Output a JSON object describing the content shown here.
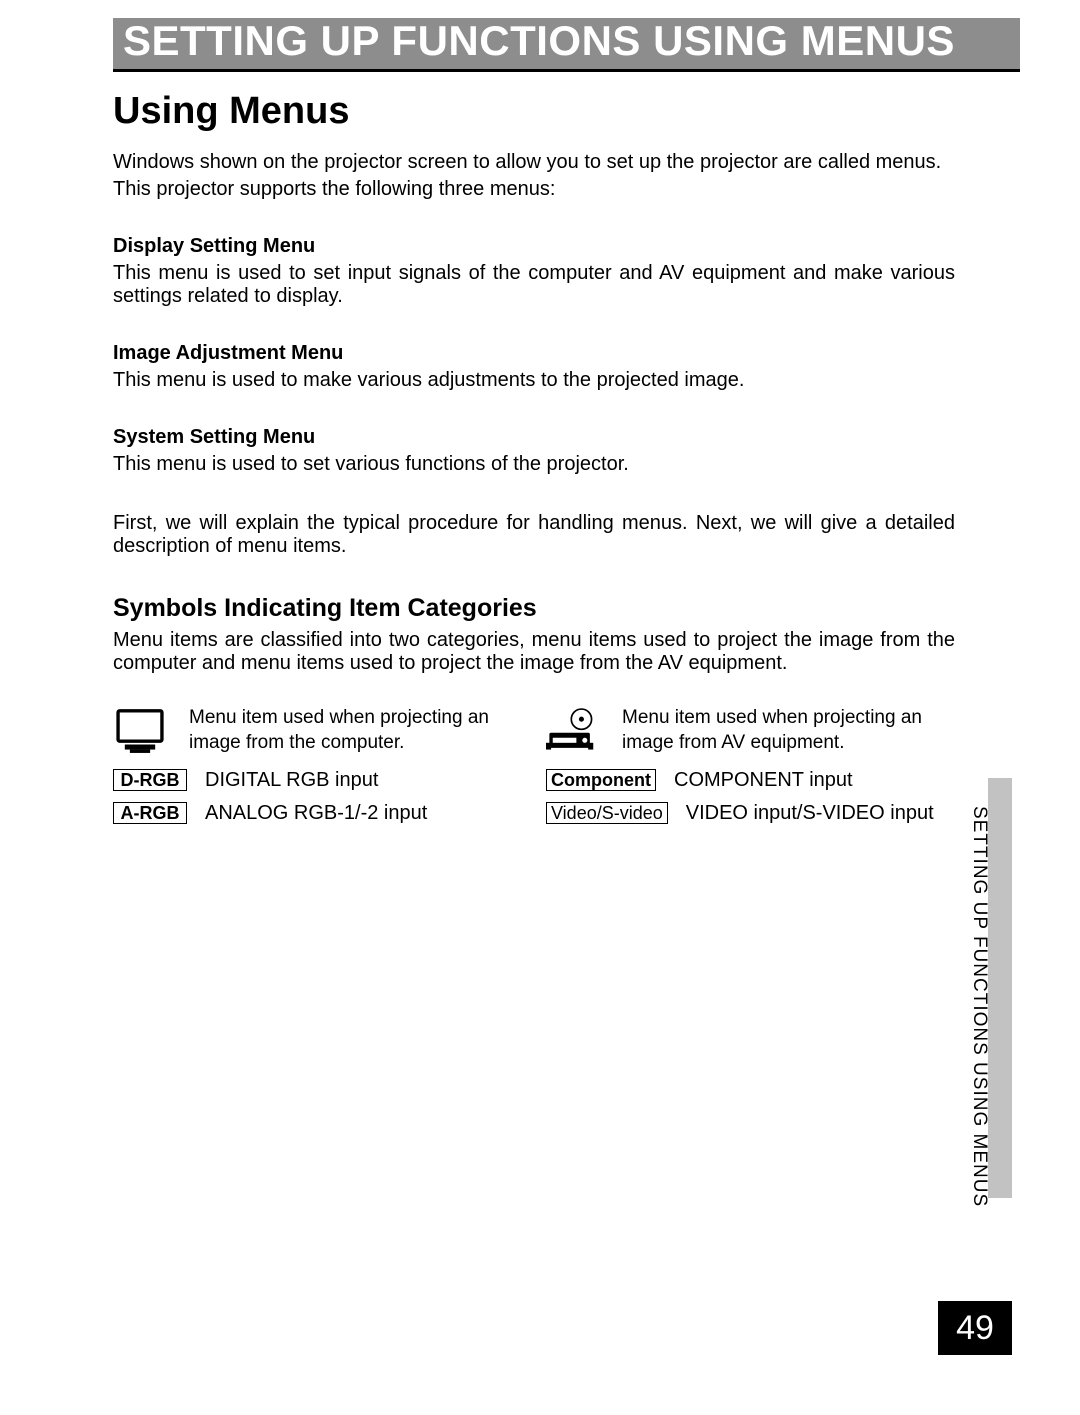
{
  "header": {
    "title": "SETTING UP FUNCTIONS USING MENUS"
  },
  "section_title": "Using Menus",
  "intro1": "Windows shown on the projector screen to allow you to set up the projector are called menus.",
  "intro2": "This projector supports the following three menus:",
  "menus": [
    {
      "head": "Display Setting Menu",
      "desc": "This menu is used to set input signals of the computer and AV equipment and make various settings related to display."
    },
    {
      "head": "Image Adjustment Menu",
      "desc": "This menu is used to make various adjustments to the projected image."
    },
    {
      "head": "System Setting Menu",
      "desc": "This menu is used to set various functions of the projector."
    }
  ],
  "follow": "First, we will explain the typical procedure for handling menus. Next, we will give a detailed description of menu items.",
  "sub_title": "Symbols Indicating Item Categories",
  "sub_desc": "Menu items are classified into two categories, menu items used to project the image from the computer and menu items used to project the image from the AV equipment.",
  "left": {
    "icon_desc": "Menu item used when projecting an image from the computer.",
    "rows": [
      {
        "label": "D-RGB",
        "text": "DIGITAL RGB input",
        "style": "bold"
      },
      {
        "label": "A-RGB",
        "text": "ANALOG RGB-1/-2 input",
        "style": "bold"
      }
    ]
  },
  "right": {
    "icon_desc": "Menu item used when projecting an image from AV equipment.",
    "rows": [
      {
        "label": "Component",
        "text": "COMPONENT input",
        "style": "bold"
      },
      {
        "label": "Video/S-video",
        "text": "VIDEO input/S-VIDEO input",
        "style": "thin"
      }
    ]
  },
  "side_label": "SETTING UP FUNCTIONS USING MENUS",
  "page_number": "49"
}
